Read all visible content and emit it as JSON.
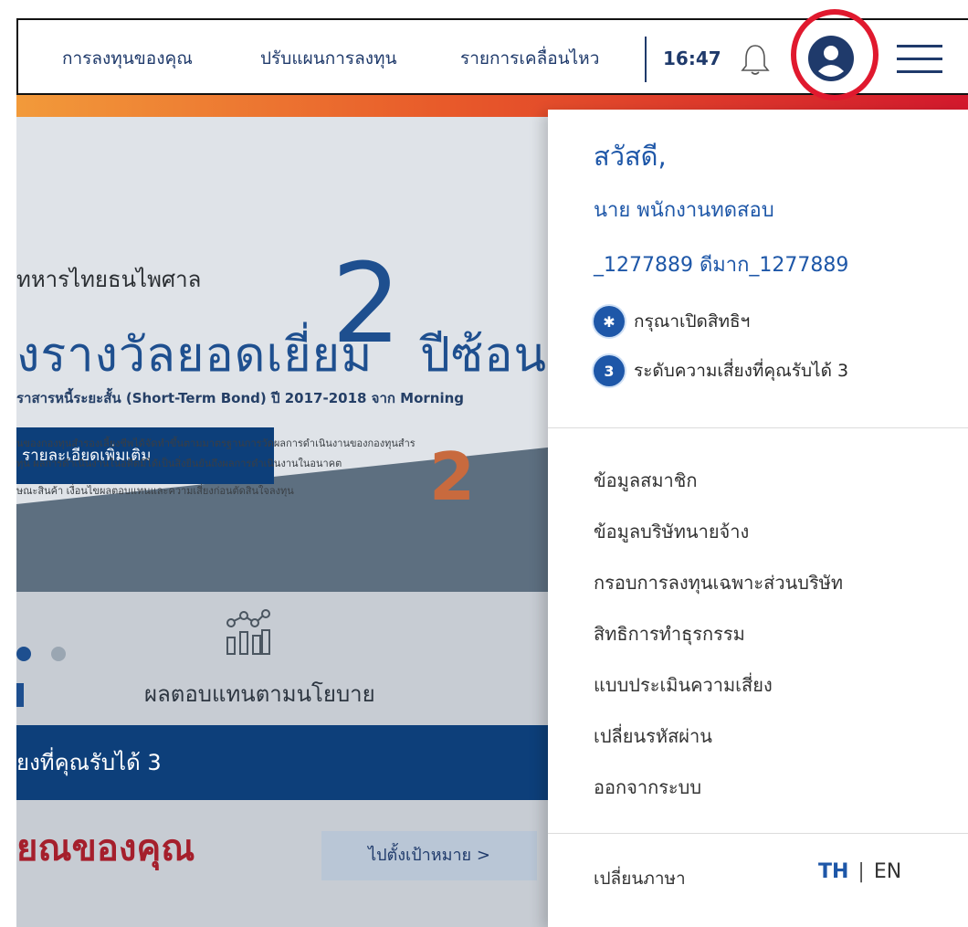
{
  "topbar": {
    "nav": [
      "การลงทุนของคุณ",
      "ปรับแผนการลงทุน",
      "รายการเคลื่อนไหว"
    ],
    "time": "16:47",
    "icons": {
      "bell": "bell-icon",
      "avatar": "user-avatar-icon",
      "menu": "hamburger-menu-icon"
    },
    "highlight_color": "#e0192e"
  },
  "background": {
    "banner_title": "ทหารไทยธนไพศาล",
    "banner_big": "งรางวัลยอดเยี่ยม",
    "banner_number": "2",
    "banner_suffix": "ปีซ้อน",
    "banner_sub": "ราสารหนี้ระยะสั้น (Short-Term Bond) ปี 2017-2018 จาก Morning",
    "banner_button": "รายละเอียดเพิ่มเติม",
    "banner_small_number": "2",
    "notes": [
      "นของกองทุนสำรองเลี้ยงชีพได้จัดทำขึ้นตามมาตรฐานการวัดผลการดำเนินงานของกองทุนสำร",
      "ทุน ผลการดำเนินงานในอดีตมิได้เป็นสิ่งยืนยันถึงผลการดำเนินงานในอนาคต",
      "ษณะสินค้า เงื่อนไขผลตอบแทนและความเสี่ยงก่อนตัดสินใจลงทุน"
    ],
    "policy_label": "ผลตอบแทนตามนโยบาย",
    "risk_band": "ยงที่คุณรับได้ 3",
    "bottom_title": "ยณของคุณ",
    "goal_button": "ไปตั้งเป้าหมาย >"
  },
  "panel": {
    "greeting": "สวัสดี,",
    "name": "นาย พนักงานทดสอบ",
    "code": "_1277889 ดีมาก_1277889",
    "status": [
      {
        "badge": "✱",
        "text": "กรุณาเปิดสิทธิฯ"
      },
      {
        "badge": "3",
        "text": "ระดับความเสี่ยงที่คุณรับได้ 3"
      }
    ],
    "links": [
      "ข้อมูลสมาชิก",
      "ข้อมูลบริษัทนายจ้าง",
      "กรอบการลงทุนเฉพาะส่วนบริษัท",
      "สิทธิการทำธุรกรรม",
      "แบบประเมินความเสี่ยง",
      "เปลี่ยนรหัสผ่าน",
      "ออกจากระบบ"
    ],
    "language_label": "เปลี่ยนภาษา",
    "lang_th": "TH",
    "lang_sep": "|",
    "lang_en": "EN",
    "accent": "#1e57a8"
  }
}
